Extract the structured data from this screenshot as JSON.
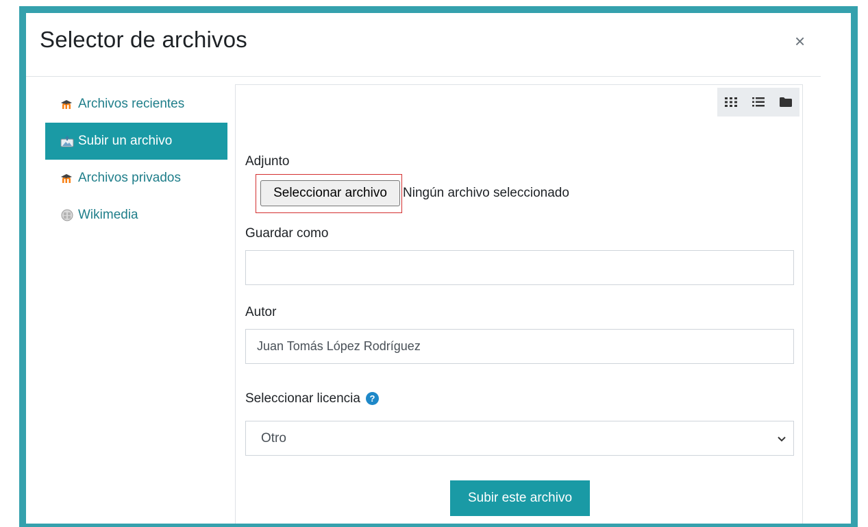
{
  "dialog": {
    "title": "Selector de archivos",
    "close_label": "×"
  },
  "sidebar": {
    "items": [
      {
        "label": "Archivos recientes",
        "icon": "moodle-icon",
        "active": false
      },
      {
        "label": "Subir un archivo",
        "icon": "upload-icon",
        "active": true
      },
      {
        "label": "Archivos privados",
        "icon": "moodle-icon",
        "active": false
      },
      {
        "label": "Wikimedia",
        "icon": "wikimedia-icon",
        "active": false
      }
    ]
  },
  "view_buttons": [
    "grid-view-icon",
    "list-view-icon",
    "folder-view-icon"
  ],
  "form": {
    "attachment_label": "Adjunto",
    "choose_file_button": "Seleccionar archivo",
    "file_status": "Ningún archivo seleccionado",
    "save_as_label": "Guardar como",
    "save_as_value": "",
    "author_label": "Autor",
    "author_value": "Juan Tomás López Rodríguez",
    "license_label": "Seleccionar licencia",
    "license_value": "Otro",
    "submit_button": "Subir este archivo"
  },
  "colors": {
    "frame": "#35a1ad",
    "accent": "#1a9aa5",
    "link": "#1f7e8a",
    "highlight": "#d32f2f"
  }
}
